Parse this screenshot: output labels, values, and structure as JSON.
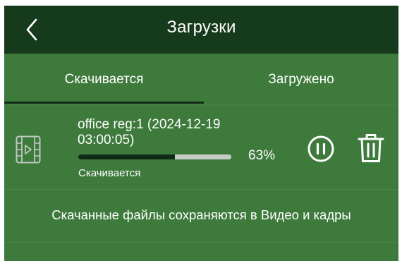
{
  "header": {
    "title": "Загрузки",
    "back_icon": "chevron-left-icon"
  },
  "tabs": [
    {
      "label": "Скачивается",
      "active": true
    },
    {
      "label": "Загружено",
      "active": false
    }
  ],
  "download": {
    "title_line1": "office reg:1 (2024-12-19",
    "title_line2": "03:00:05)",
    "progress": 0.63,
    "percent_label": "63%",
    "status": "Скачивается",
    "icon": "video-file-icon",
    "actions": {
      "pause_icon": "pause-icon",
      "delete_icon": "trash-icon"
    }
  },
  "note": "Скачанные файлы сохраняются в Видео и кадры",
  "colors": {
    "topbar": "#153a1c",
    "background": "#3e7a3c",
    "progress_fill": "#0f2b15",
    "progress_track": "#c6cbc6",
    "text": "#ffffff"
  }
}
